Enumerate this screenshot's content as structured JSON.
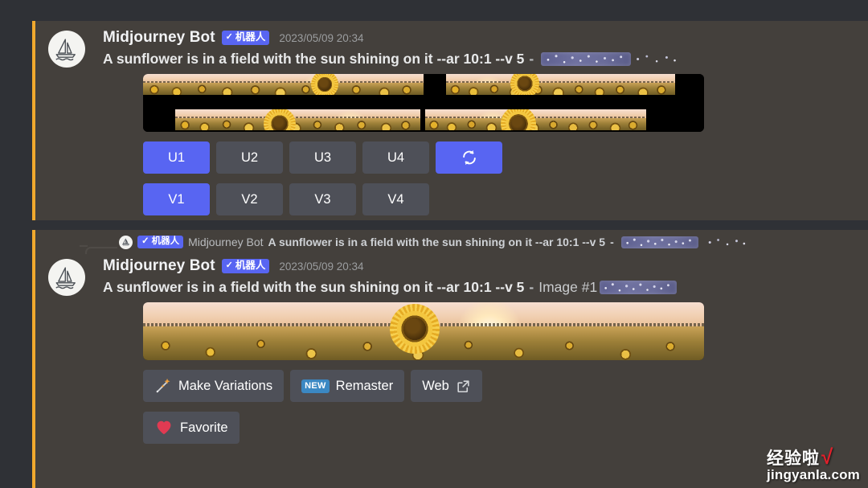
{
  "app": {
    "platform": "Discord",
    "bot": "Midjourney Bot"
  },
  "messages": [
    {
      "id": "grid-message",
      "author": "Midjourney Bot",
      "bot_badge": {
        "check": "✓",
        "label": "机器人"
      },
      "timestamp": "2023/05/09 20:34",
      "prompt": "A sunflower is in a field with the sun shining on it --ar 10:1 --v 5",
      "separator": "-",
      "suffix": "",
      "redacted_user": true,
      "images": {
        "type": "grid-2x2",
        "count": 4,
        "aspect": "10:1",
        "alt": "Four wide sunflower field images at sunset, letterboxed"
      },
      "upscale_buttons": [
        {
          "label": "U1",
          "style": "primary"
        },
        {
          "label": "U2",
          "style": "secondary"
        },
        {
          "label": "U3",
          "style": "secondary"
        },
        {
          "label": "U4",
          "style": "secondary"
        }
      ],
      "refresh_button": {
        "icon": "refresh-icon",
        "style": "primary"
      },
      "variation_buttons": [
        {
          "label": "V1",
          "style": "primary"
        },
        {
          "label": "V2",
          "style": "secondary"
        },
        {
          "label": "V3",
          "style": "secondary"
        },
        {
          "label": "V4",
          "style": "secondary"
        }
      ]
    },
    {
      "id": "upscale-message",
      "reply": {
        "badge": {
          "check": "✓",
          "label": "机器人"
        },
        "author": "Midjourney Bot",
        "text": "A sunflower is in a field with the sun shining on it --ar 10:1 --v 5",
        "separator": "-",
        "redacted_user": true
      },
      "author": "Midjourney Bot",
      "bot_badge": {
        "check": "✓",
        "label": "机器人"
      },
      "timestamp": "2023/05/09 20:34",
      "prompt": "A sunflower is in a field with the sun shining on it --ar 10:1 --v 5",
      "separator": "-",
      "suffix": "Image #1",
      "redacted_user": true,
      "images": {
        "type": "single",
        "count": 1,
        "aspect": "10:1",
        "alt": "Wide sunflower field at sunset with one large sunflower in the center"
      },
      "action_buttons": [
        {
          "label": "Make Variations",
          "icon": "sparkle-wand-icon",
          "style": "secondary"
        },
        {
          "label": "Remaster",
          "icon": "new-badge",
          "badge_text": "NEW",
          "style": "secondary"
        },
        {
          "label": "Web",
          "icon": "external-link-icon",
          "style": "secondary"
        }
      ],
      "favorite_button": {
        "label": "Favorite",
        "icon": "heart-icon",
        "style": "secondary"
      }
    }
  ],
  "watermark": {
    "cn": "经验啦",
    "check": "√",
    "url": "jingyanla.com"
  },
  "colors": {
    "message_bg": "#44403c",
    "highlight_border": "#f0a92e",
    "primary_button": "#5865f2",
    "secondary_button": "#4e5058",
    "bot_badge": "#5865f2",
    "new_badge": "#3b88c3",
    "heart": "#e03a52",
    "page_bg": "#2f3136"
  }
}
